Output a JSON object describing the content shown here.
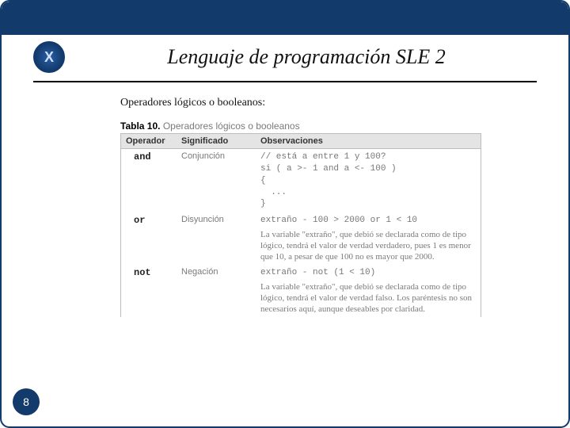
{
  "header": {
    "title": "Lenguaje de programación SLE 2",
    "logo_letter": "X"
  },
  "content": {
    "subtitle": "Operadores lógicos o booleanos:",
    "table_label": "Tabla 10.",
    "table_caption": "Operadores lógicos o booleanos",
    "columns": {
      "op": "Operador",
      "sig": "Significado",
      "obs": "Observaciones"
    },
    "rows": [
      {
        "op": "and",
        "sig": "Conjunción",
        "code": "// está a entre 1 y 100?\nsi ( a >- 1 and a <- 100 )\n{\n  ...\n}",
        "note": ""
      },
      {
        "op": "or",
        "sig": "Disyunción",
        "code": "extraño - 100 > 2000 or 1 < 10",
        "note": "La variable \"extraño\", que debió se declarada como de tipo lógico, tendrá el valor de verdad verdadero, pues 1 es menor que 10, a pesar de que 100 no es mayor que 2000."
      },
      {
        "op": "not",
        "sig": "Negación",
        "code": "extraño - not (1 < 10)",
        "note": "La variable \"extraño\", que debió se declarada como de tipo lógico, tendrá el valor de verdad falso. Los paréntesis no son necesarios aquí, aunque deseables por claridad."
      }
    ]
  },
  "page_number": "8"
}
